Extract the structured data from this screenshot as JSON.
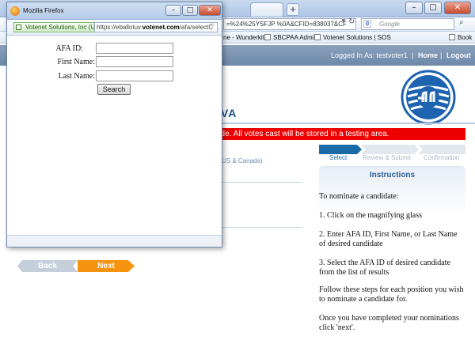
{
  "popup": {
    "window_title": "Mozilla Firefox",
    "site_identity": "Votenet Solutions, Inc (US)",
    "url_prefix": "https://eballotuv.",
    "url_domain": "votenet.com",
    "url_suffix": "/afa/selectC",
    "form": {
      "afa_id_label": "AFA ID:",
      "first_name_label": "First Name:",
      "last_name_label": "Last Name:",
      "afa_id_value": "",
      "first_name_value": "",
      "last_name_value": "",
      "search_label": "Search"
    }
  },
  "browser": {
    "address": "=%24%25YSFJP %0A&CFID=838037&CF",
    "search_placeholder": "Google",
    "bookmarks": [
      "ne - Wunderkit",
      "SBCPAA Admin",
      "Votenet Solutions | SOS",
      "Book"
    ]
  },
  "header": {
    "logged_in": "Logged In As: testvoter1",
    "sep": "|",
    "home": "Home",
    "logout": "Logout"
  },
  "page": {
    "org_title": "VA",
    "test_banner": "ode. All votes cast will be stored in a testing area.",
    "country_note": "US & Canada)"
  },
  "steps": [
    {
      "label": "Select",
      "active": true
    },
    {
      "label": "Review & Submit",
      "active": false
    },
    {
      "label": "Confirmation",
      "active": false
    }
  ],
  "instructions": {
    "title": "Instructions",
    "paragraphs": [
      "To nominate a candidate:",
      "1. Click on the magnifying glass",
      "2. Enter AFA ID, First Name, or Last Name of desired candidate",
      "3. Select the AFA ID of desired candidate from the list of results",
      "Follow these steps for each position you wish to nominate a candidate for.",
      "Once you have completed your nominations click 'next'."
    ]
  },
  "nav": {
    "back": "Back",
    "next": "Next"
  },
  "colors": {
    "header": "#7b95b4",
    "banner": "#ef0000",
    "next": "#f7940f",
    "back": "#c4cfdb",
    "step_active": "#1f6fb7"
  }
}
